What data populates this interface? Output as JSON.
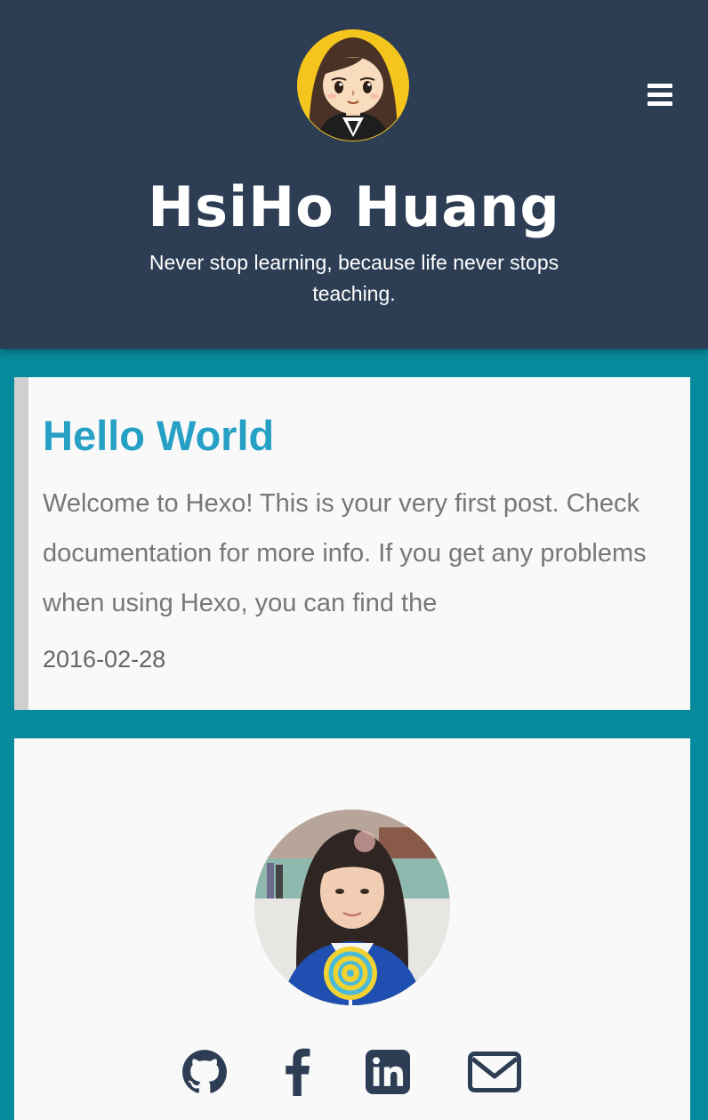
{
  "header": {
    "title": "HsiHo Huang",
    "tagline": "Never stop learning, because life never stops teaching.",
    "logo_icon": "cartoon-avatar-icon",
    "menu_icon": "hamburger-menu-icon"
  },
  "posts": [
    {
      "title": "Hello World",
      "excerpt": "Welcome to Hexo! This is your very first post. Check documentation for more info. If you get any problems when using Hexo, you can find the",
      "date": "2016-02-28"
    }
  ],
  "profile": {
    "photo_icon": "profile-photo",
    "social_icons": [
      "github-icon",
      "facebook-icon",
      "linkedin-icon",
      "mail-icon"
    ]
  },
  "colors": {
    "header_bg": "#2d3d53",
    "page_bg": "#078a9b",
    "accent": "#27a0c6",
    "icon": "#2d3d53"
  }
}
